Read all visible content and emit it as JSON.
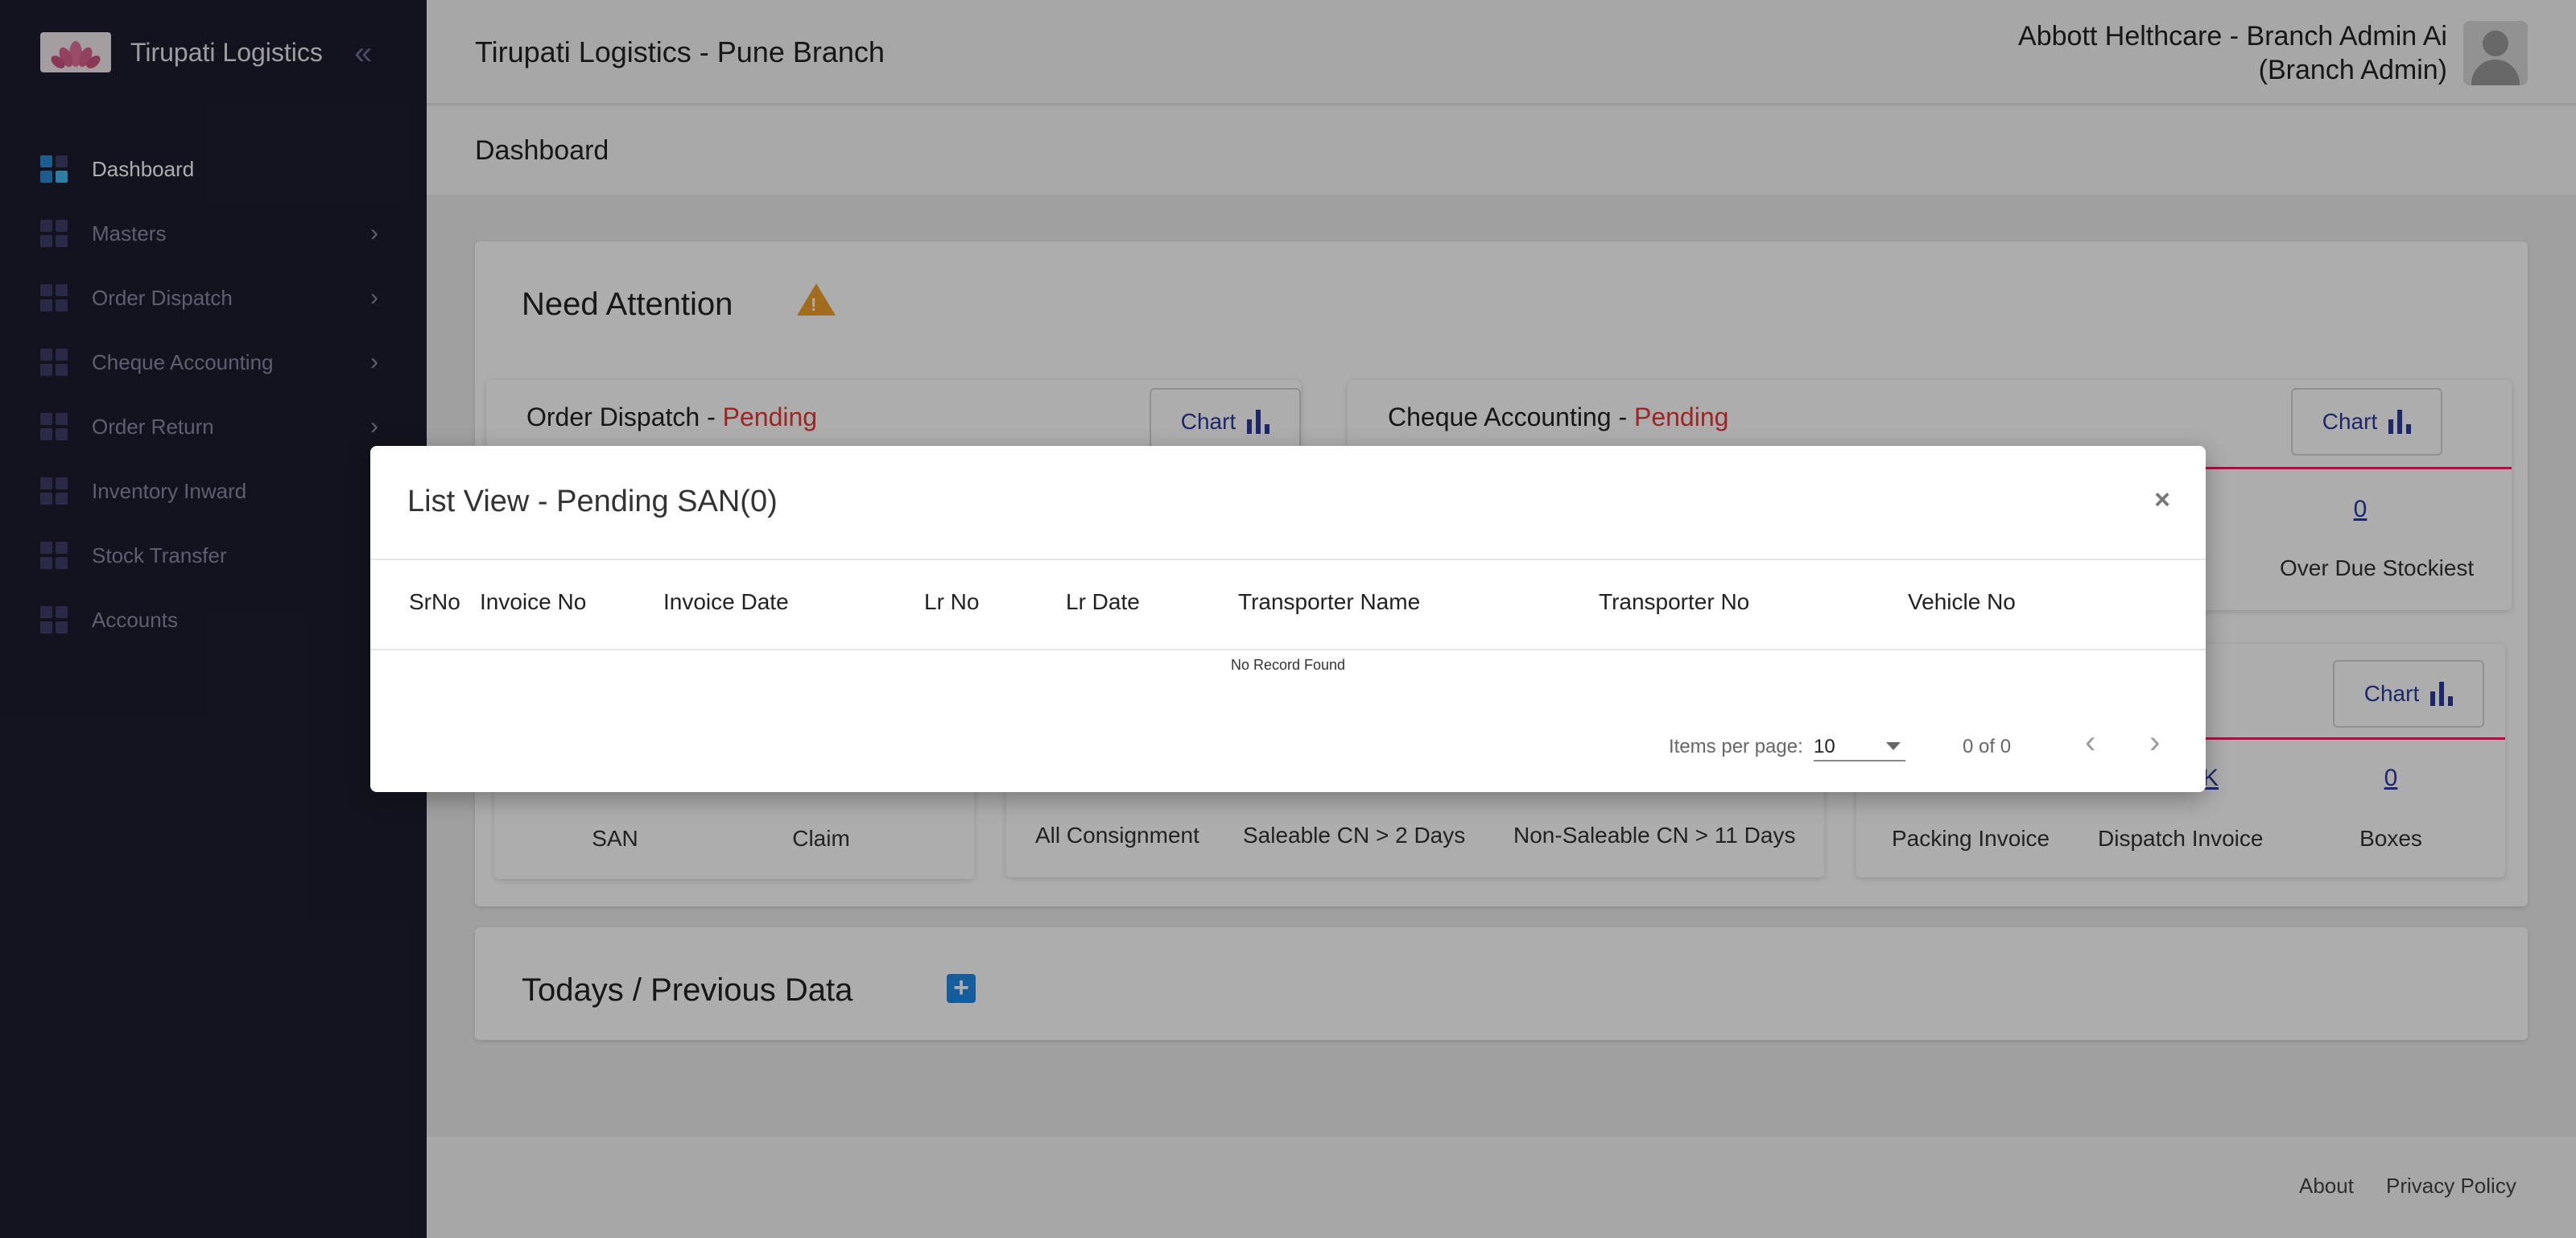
{
  "sidebar": {
    "brand_name": "Tirupati Logistics",
    "items": [
      {
        "label": "Dashboard",
        "active": true,
        "has_children": false
      },
      {
        "label": "Masters",
        "active": false,
        "has_children": true
      },
      {
        "label": "Order Dispatch",
        "active": false,
        "has_children": true
      },
      {
        "label": "Cheque Accounting",
        "active": false,
        "has_children": true
      },
      {
        "label": "Order Return",
        "active": false,
        "has_children": true
      },
      {
        "label": "Inventory Inward",
        "active": false,
        "has_children": false
      },
      {
        "label": "Stock Transfer",
        "active": false,
        "has_children": false
      },
      {
        "label": "Accounts",
        "active": false,
        "has_children": false
      }
    ]
  },
  "header": {
    "title": "Tirupati Logistics - Pune Branch",
    "user_name": "Abbott Helthcare - Branch Admin Ai",
    "user_role": "(Branch Admin)"
  },
  "page": {
    "title": "Dashboard"
  },
  "need_attention": {
    "title": "Need Attention",
    "order_dispatch": {
      "title": "Order Dispatch - ",
      "status": "Pending",
      "chart_label": "Chart"
    },
    "cheque_accounting": {
      "title": "Cheque Accounting - ",
      "status": "Pending",
      "chart_label": "Chart",
      "metric_value": "0",
      "metric_label": "Over Due Stockiest"
    },
    "order_return": {
      "san_label": "SAN",
      "claim_label": "Claim"
    },
    "consignment": {
      "labels": [
        "All Consignment",
        "Saleable CN > 2 Days",
        "Non-Saleable CN > 11 Days"
      ]
    },
    "packing": {
      "chart_label": "Chart",
      "dispatch_value_partial": "K",
      "boxes_value": "0",
      "labels": [
        "Packing Invoice",
        "Dispatch Invoice",
        "Boxes"
      ]
    }
  },
  "todays_data": {
    "title": "Todays / Previous Data",
    "add_symbol": "+"
  },
  "footer": {
    "about": "About",
    "privacy": "Privacy Policy"
  },
  "modal": {
    "title": "List View - Pending SAN(0)",
    "close_symbol": "×",
    "columns": [
      "SrNo",
      "Invoice No",
      "Invoice Date",
      "Lr No",
      "Lr Date",
      "Transporter Name",
      "Transporter No",
      "Vehicle No"
    ],
    "empty_text": "No Record Found",
    "items_per_page_label": "Items per page:",
    "items_per_page_value": "10",
    "range_label": "0 of 0"
  },
  "colors": {
    "sidebar_bg": "#1c1d2e",
    "pending": "#e53935",
    "link": "#2b3a9c",
    "accent": "#1e88e5"
  }
}
